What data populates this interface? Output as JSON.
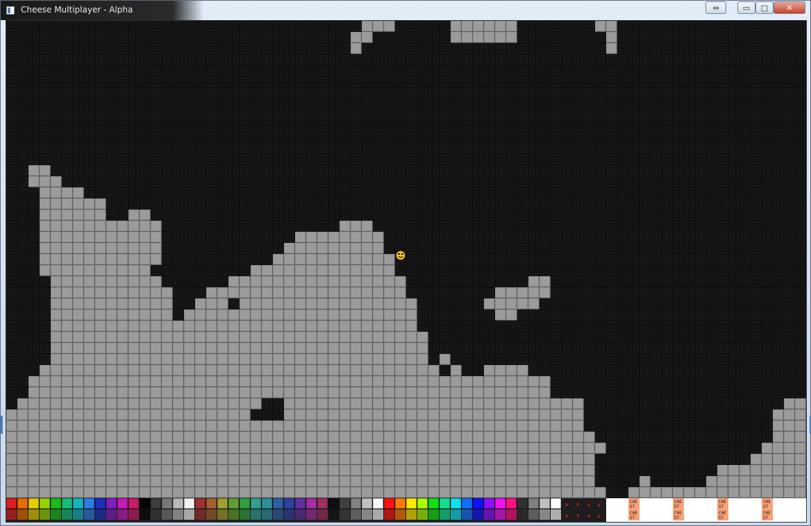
{
  "window": {
    "title": "Cheese Multiplayer - Alpha",
    "icons": [
      "app-icon",
      "resize-arrows-icon",
      "minimize-icon",
      "maximize-icon",
      "close-icon"
    ]
  },
  "colors": {
    "background_block": "#0d0d0d",
    "solid_block": "#8f8f8f",
    "player": "#f2c33c",
    "chest": "#f4a37a"
  },
  "palette_row1": [
    "#d91e1e",
    "#e66c00",
    "#e6cd00",
    "#96d400",
    "#1cbc1c",
    "#16bd7a",
    "#16b3c2",
    "#2f7be0",
    "#1c2fbf",
    "#7f1dbf",
    "#c21cb8",
    "#c81c66",
    "#050505",
    "#3c3c3c",
    "#777777",
    "#b8b8b8",
    "#f2f2f2",
    "#a03030",
    "#a06030",
    "#a0a030",
    "#60a030",
    "#30a040",
    "#30a090",
    "#3090a0",
    "#3060a0",
    "#3040a0",
    "#6030a0",
    "#a030a0",
    "#a03060",
    "#101010",
    "#404040",
    "#808080",
    "#c0c0c0",
    "#f8f8f8",
    "#ff1010",
    "#ff7a00",
    "#ffe800",
    "#a8ff00",
    "#14e014",
    "#10e090",
    "#10e0f0",
    "#1070ff",
    "#1010ff",
    "#8a10ff",
    "#f010f0",
    "#ff1080",
    "#303030",
    "#808080",
    "#c0c0c0",
    "#fbfbfb"
  ],
  "player": {
    "name": "player-smiley",
    "col": 35,
    "row": 21
  },
  "chest_label": "CHE ST",
  "chest_count": 4
}
